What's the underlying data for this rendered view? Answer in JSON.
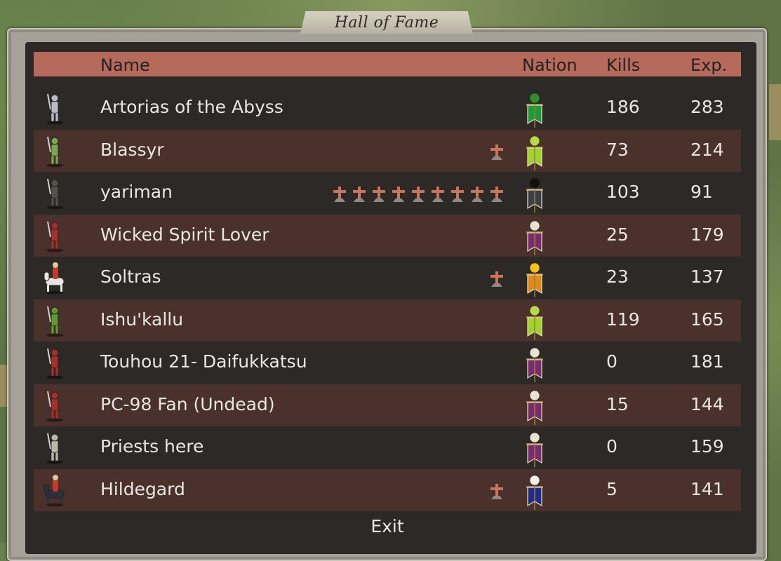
{
  "title": "Hall of Fame",
  "columns": {
    "name": "Name",
    "nation": "Nation",
    "kills": "Kills",
    "exp": "Exp."
  },
  "rows": [
    {
      "name": "Artorias of the Abyss",
      "kills": "186",
      "exp": "283",
      "medals": 0,
      "nation": "green-tree",
      "unit": "armored-knight"
    },
    {
      "name": "Blassyr",
      "kills": "73",
      "exp": "214",
      "medals": 1,
      "nation": "lime-serpent",
      "unit": "lizard-warrior"
    },
    {
      "name": "yariman",
      "kills": "103",
      "exp": "91",
      "medals": 9,
      "nation": "dark-wing",
      "unit": "dark-soldier"
    },
    {
      "name": "Wicked Spirit Lover",
      "kills": "25",
      "exp": "179",
      "medals": 0,
      "nation": "purple-skull",
      "unit": "red-axeman"
    },
    {
      "name": "Soltras",
      "kills": "23",
      "exp": "137",
      "medals": 1,
      "nation": "orange-sun",
      "unit": "white-horse-knight"
    },
    {
      "name": "Ishu'kallu",
      "kills": "119",
      "exp": "165",
      "medals": 0,
      "nation": "lime-serpent",
      "unit": "lizard-spearman"
    },
    {
      "name": "Touhou 21- Daifukkatsu",
      "kills": "0",
      "exp": "181",
      "medals": 0,
      "nation": "purple-skull",
      "unit": "red-axeman"
    },
    {
      "name": "PC-98 Fan (Undead)",
      "kills": "15",
      "exp": "144",
      "medals": 0,
      "nation": "purple-skull",
      "unit": "red-axeman"
    },
    {
      "name": "Priests here",
      "kills": "0",
      "exp": "159",
      "medals": 0,
      "nation": "purple-skull",
      "unit": "priest"
    },
    {
      "name": "Hildegard",
      "kills": "5",
      "exp": "141",
      "medals": 1,
      "nation": "blue-moon",
      "unit": "dark-horse-rider"
    }
  ],
  "exit_label": "Exit",
  "colors": {
    "header": "#b56a5b",
    "row_alt": "#4a312b",
    "panel": "#221f1d",
    "medal": "#c8755c"
  },
  "banners": {
    "green-tree": {
      "cloth": "#1e9a3a",
      "emblem": "#2f8f2a"
    },
    "lime-serpent": {
      "cloth": "#9ed42a",
      "emblem": "#b9d84a"
    },
    "dark-wing": {
      "cloth": "#3b3f48",
      "emblem": "#111111"
    },
    "purple-skull": {
      "cloth": "#7a2b6e",
      "emblem": "#e9e2cf"
    },
    "orange-sun": {
      "cloth": "#e08a1a",
      "emblem": "#f4c21a"
    },
    "blue-moon": {
      "cloth": "#1c2e8a",
      "emblem": "#f2f0e8"
    }
  },
  "units": {
    "armored-knight": "#b8bcc8",
    "lizard-warrior": "#7aa84a",
    "dark-soldier": "#55504a",
    "red-axeman": "#a8302a",
    "white-horse-knight": "#e8e6e0",
    "lizard-spearman": "#5f9a2f",
    "priest": "#b8b9a8",
    "dark-horse-rider": "#2d2f3a"
  }
}
